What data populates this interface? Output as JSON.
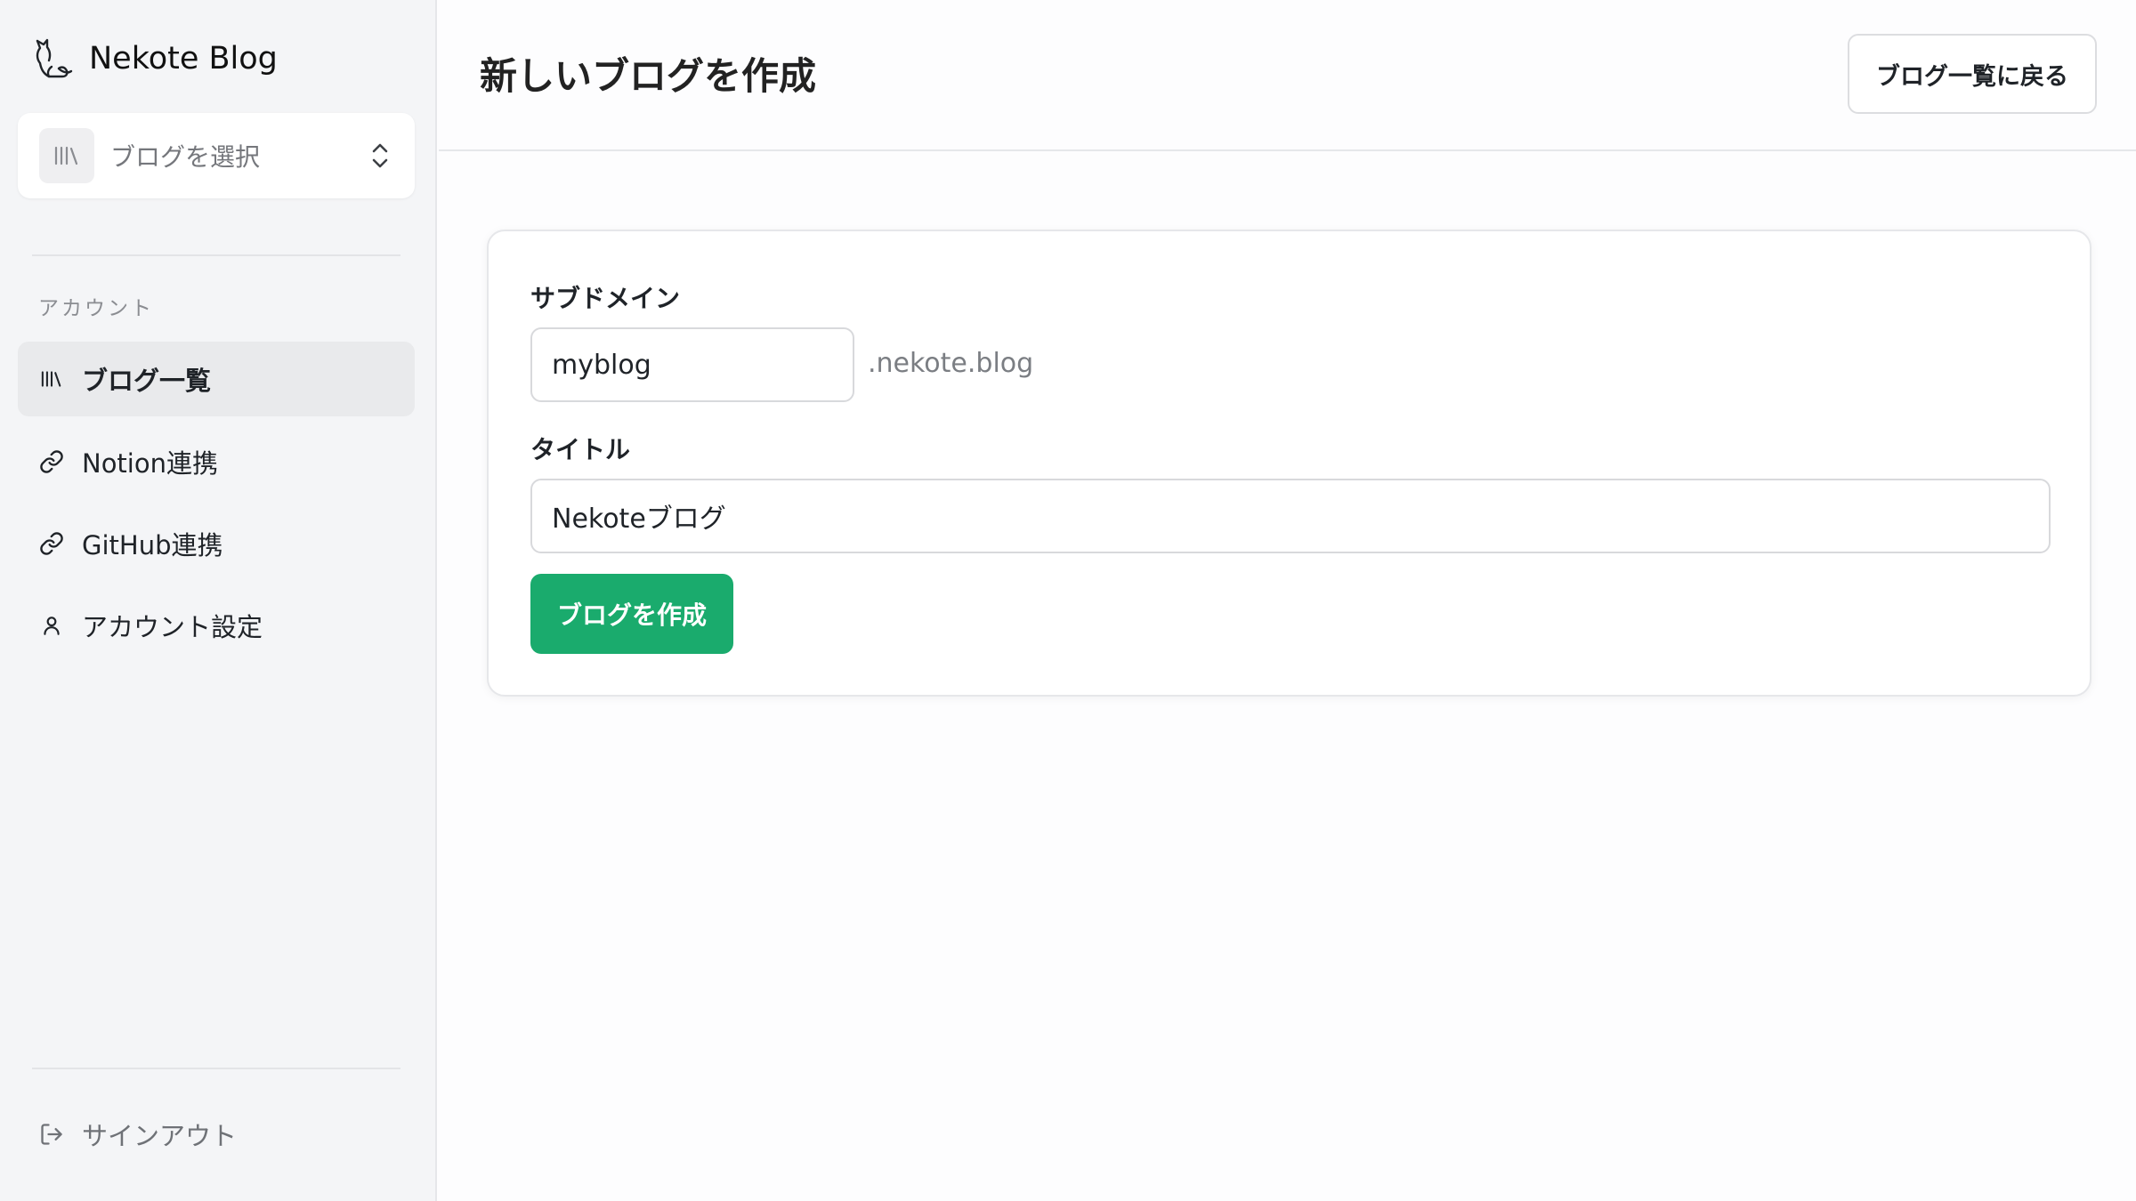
{
  "brand": {
    "name": "Nekote Blog"
  },
  "sidebar": {
    "blog_select": {
      "placeholder": "ブログを選択"
    },
    "section_label": "アカウント",
    "items": [
      {
        "label": "ブログ一覧",
        "icon": "library-icon",
        "active": true
      },
      {
        "label": "Notion連携",
        "icon": "link-icon",
        "active": false
      },
      {
        "label": "GitHub連携",
        "icon": "link-icon",
        "active": false
      },
      {
        "label": "アカウント設定",
        "icon": "user-icon",
        "active": false
      }
    ],
    "signout": {
      "label": "サインアウト",
      "icon": "log-out-icon"
    }
  },
  "header": {
    "title": "新しいブログを作成",
    "back_label": "ブログ一覧に戻る"
  },
  "form": {
    "subdomain_label": "サブドメイン",
    "subdomain_value": "myblog",
    "subdomain_suffix": ".nekote.blog",
    "title_label": "タイトル",
    "title_value": "Nekoteブログ",
    "submit_label": "ブログを作成"
  },
  "colors": {
    "accent": "#1aab6d",
    "sidebar_bg": "#f4f5f7",
    "active_item_bg": "#e9eaec"
  }
}
